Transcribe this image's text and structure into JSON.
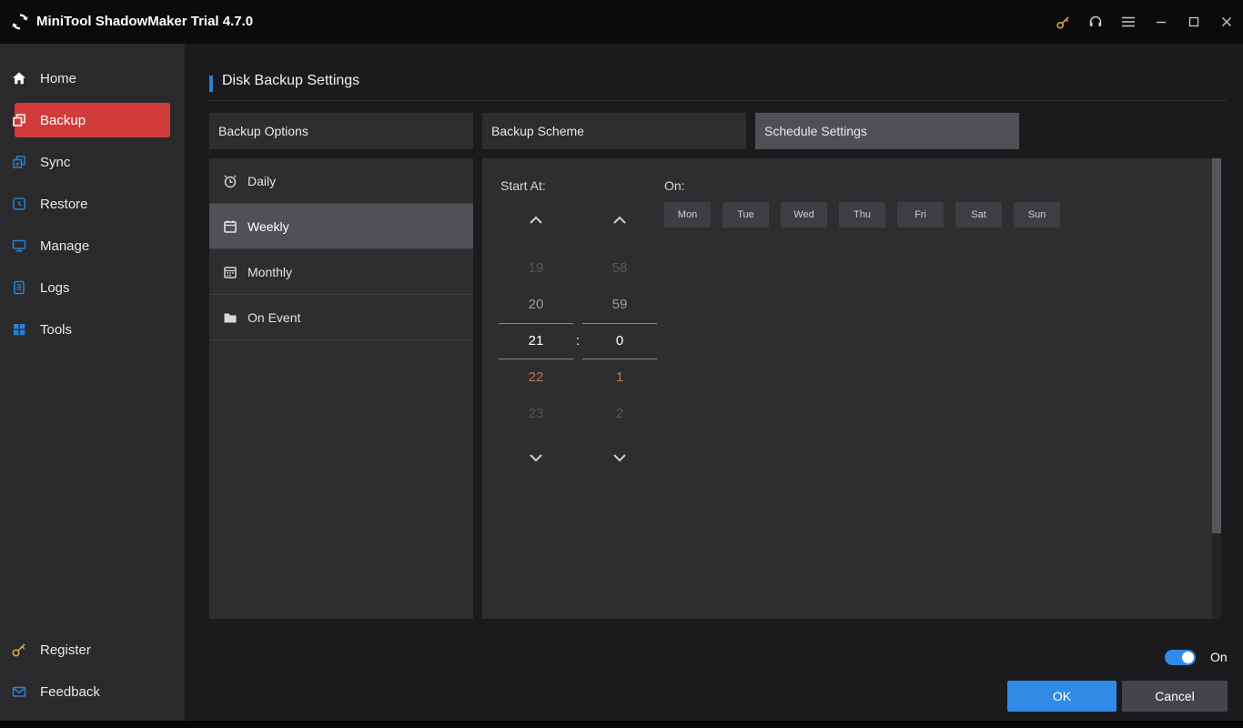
{
  "titlebar": {
    "app_title": "MiniTool ShadowMaker Trial 4.7.0",
    "icons": [
      "key-icon",
      "headset-icon",
      "menu-icon",
      "minimize-icon",
      "maximize-icon",
      "close-icon"
    ]
  },
  "sidebar": {
    "items": [
      {
        "label": "Home",
        "icon": "home-icon",
        "active": false
      },
      {
        "label": "Backup",
        "icon": "backup-icon",
        "active": true
      },
      {
        "label": "Sync",
        "icon": "sync-icon",
        "active": false
      },
      {
        "label": "Restore",
        "icon": "restore-icon",
        "active": false
      },
      {
        "label": "Manage",
        "icon": "manage-icon",
        "active": false
      },
      {
        "label": "Logs",
        "icon": "logs-icon",
        "active": false
      },
      {
        "label": "Tools",
        "icon": "tools-icon",
        "active": false
      }
    ],
    "footer_items": [
      {
        "label": "Register",
        "icon": "key-icon"
      },
      {
        "label": "Feedback",
        "icon": "mail-icon"
      }
    ]
  },
  "page": {
    "title": "Disk Backup Settings"
  },
  "tabs": [
    {
      "label": "Backup Options",
      "active": false
    },
    {
      "label": "Backup Scheme",
      "active": false
    },
    {
      "label": "Schedule Settings",
      "active": true
    }
  ],
  "schedule": {
    "frequency_options": [
      {
        "label": "Daily",
        "icon": "clock-icon",
        "selected": false
      },
      {
        "label": "Weekly",
        "icon": "calendar-icon",
        "selected": true
      },
      {
        "label": "Monthly",
        "icon": "calendar-grid-icon",
        "selected": false
      },
      {
        "label": "On Event",
        "icon": "folder-icon",
        "selected": false
      }
    ],
    "start_at_label": "Start At:",
    "hours": [
      "19",
      "20",
      "21",
      "22",
      "23"
    ],
    "minutes": [
      "58",
      "59",
      "0",
      "1",
      "2"
    ],
    "selected_hour": "21",
    "selected_minute": "0",
    "time_separator": ":",
    "on_label": "On:",
    "days": [
      "Mon",
      "Tue",
      "Wed",
      "Thu",
      "Fri",
      "Sat",
      "Sun"
    ]
  },
  "footer": {
    "toggle_state": "On",
    "ok_label": "OK",
    "cancel_label": "Cancel"
  },
  "colors": {
    "titlebar_bg": "#0b0b0c",
    "sidebar_bg": "#2a2a2d",
    "main_bg": "#1b1b1e",
    "panel_bg": "#2e2e31",
    "active_tab": "#504f53",
    "accent_red": "#d23b3b",
    "accent_blue": "#2b7fd4",
    "ok_blue": "#2f8be6",
    "gold": "#d4a93c",
    "next_value_orange": "#b97844"
  }
}
